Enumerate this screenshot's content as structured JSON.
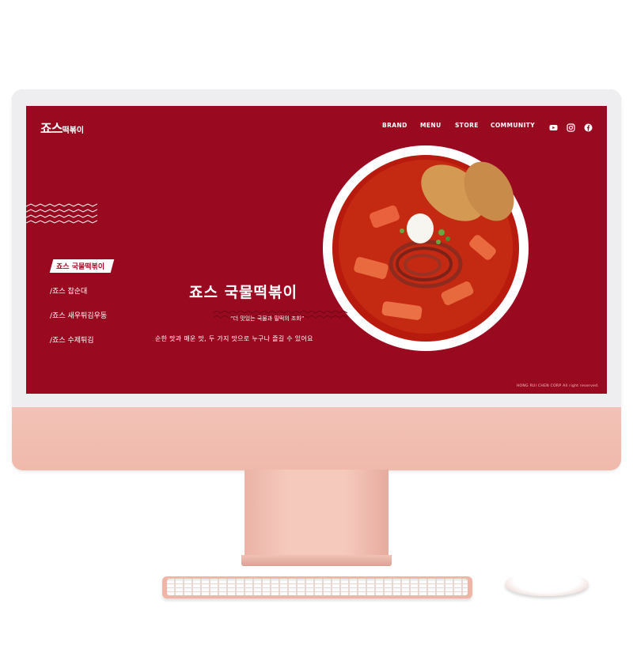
{
  "site": {
    "logo_main": "죠스",
    "logo_sub": "떡볶이",
    "nav": [
      "BRAND",
      "MENU",
      "STORE",
      "COMMUNITY"
    ],
    "social_icons": [
      "youtube-icon",
      "instagram-icon",
      "facebook-icon"
    ]
  },
  "sidebar": {
    "items": [
      {
        "label": "죠스 국물떡볶이",
        "active": true
      },
      {
        "label": "죠스 찹순대",
        "active": false
      },
      {
        "label": "죠스 새우튀김우동",
        "active": false
      },
      {
        "label": "죠스 수제튀김",
        "active": false
      }
    ]
  },
  "hero": {
    "title": "죠스 국물떡볶이",
    "quote": "“더 맛있는 국물과 밀떡의 조화”",
    "description": "순한 맛과 매운 맛, 두 가지 맛으로 누구나 즐길 수 있어요"
  },
  "footer": {
    "copyright": "HONG RUI CHEN CORP All right reserved."
  },
  "colors": {
    "brand_red": "#990a20",
    "device_pink": "#f4c4b8"
  }
}
